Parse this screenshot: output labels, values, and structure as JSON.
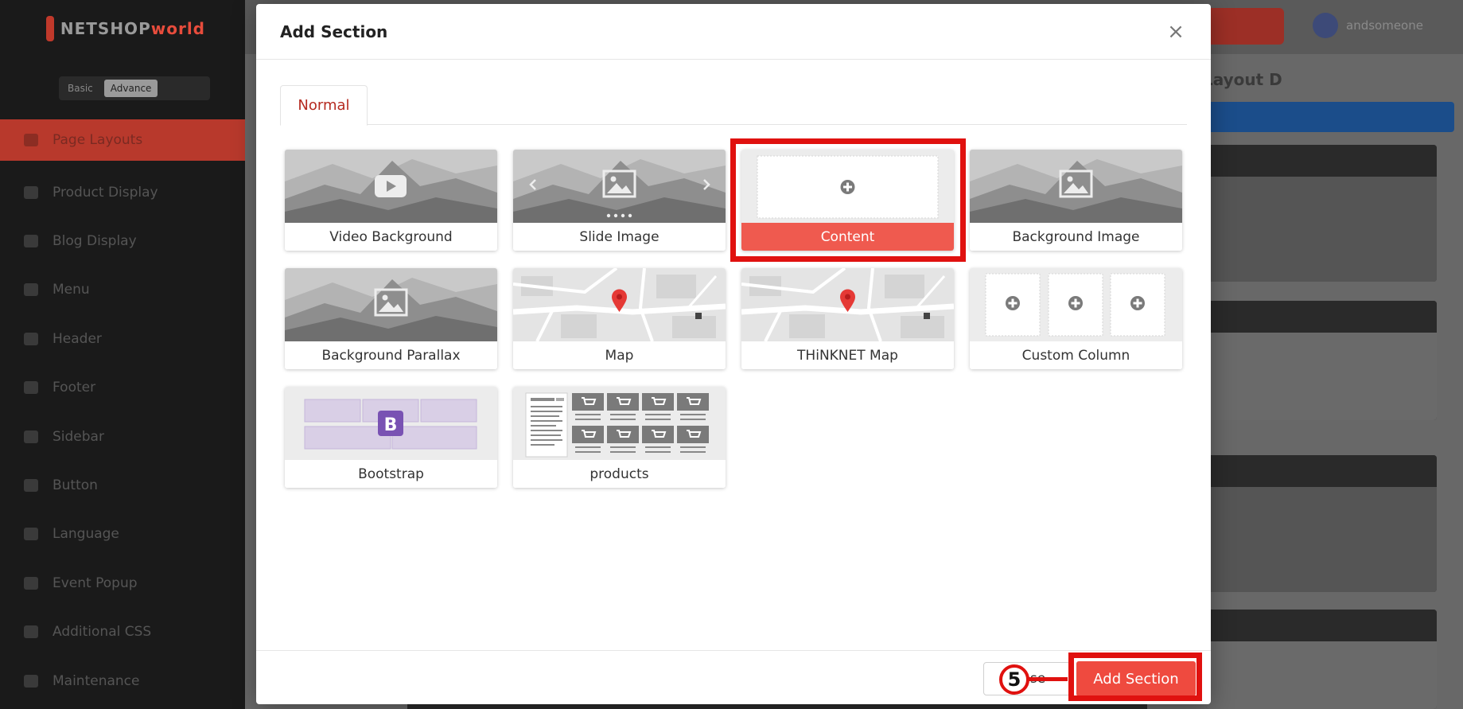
{
  "modal": {
    "title": "Add Section",
    "close_symbol": "×",
    "tabs": [
      {
        "label": "Normal",
        "active": true
      }
    ],
    "sections": [
      {
        "label": "Video Background",
        "thumb": "mountain-video"
      },
      {
        "label": "Slide Image",
        "thumb": "mountain-slide"
      },
      {
        "label": "Content",
        "thumb": "content-plus",
        "selected": true
      },
      {
        "label": "Background Image",
        "thumb": "mountain-image"
      },
      {
        "label": "Background Parallax",
        "thumb": "mountain-image"
      },
      {
        "label": "Map",
        "thumb": "map"
      },
      {
        "label": "THiNKNET Map",
        "thumb": "map"
      },
      {
        "label": "Custom Column",
        "thumb": "columns-plus"
      },
      {
        "label": "Bootstrap",
        "thumb": "bootstrap-grid"
      },
      {
        "label": "products",
        "thumb": "product-grid"
      }
    ],
    "footer": {
      "close_label": "Close",
      "add_label": "Add Section"
    }
  },
  "annotation": {
    "step_number": "5",
    "color": "#e0110f"
  },
  "colors": {
    "accent": "#ef4a3f",
    "tab_text": "#b52a20",
    "selected_label_bg": "#ef5a4f"
  }
}
